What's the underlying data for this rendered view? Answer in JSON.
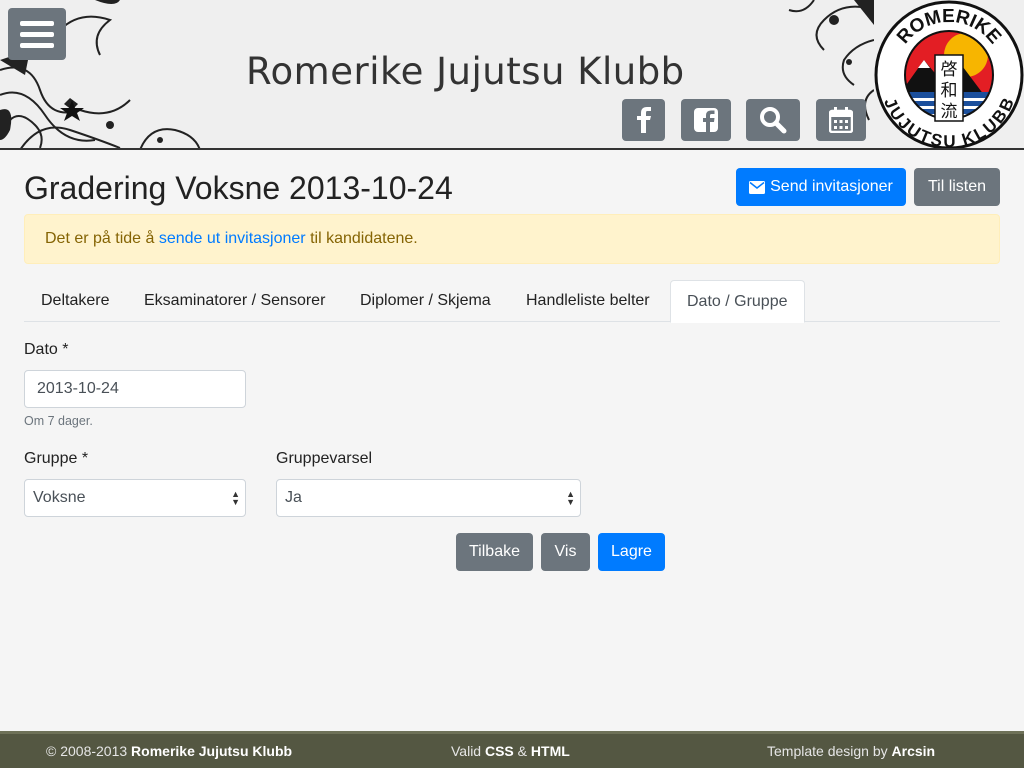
{
  "header": {
    "site_title": "Romerike Jujutsu Klubb",
    "menu_icon": "hamburger-menu-icon",
    "icons": [
      "facebook-icon",
      "facebook-square-icon",
      "search-icon",
      "calendar-icon"
    ],
    "logo": {
      "top_text": "ROMERIKE",
      "bottom_text": "JUJUTSU KLUBB",
      "kanji": [
        "啓",
        "和",
        "流"
      ]
    }
  },
  "main": {
    "title": "Gradering Voksne 2013-10-24",
    "send_button": "Send invitasjoner",
    "send_icon": "envelope-icon",
    "list_button": "Til listen",
    "alert": {
      "prefix": "Det er på tide å",
      "link": "sende ut invitasjoner",
      "suffix": "til kandidatene."
    },
    "tabs": [
      "Deltakere",
      "Eksaminatorer / Sensorer",
      "Diplomer / Skjema",
      "Handleliste belter",
      "Dato / Gruppe"
    ],
    "active_tab": "Dato / Gruppe",
    "form": {
      "date_label": "Dato *",
      "date_value": "2013-10-24",
      "date_help": "Om 7 dager.",
      "group_label": "Gruppe *",
      "group_value": "Voksne",
      "notify_label": "Gruppevarsel",
      "notify_value": "Ja"
    },
    "actions": {
      "back": "Tilbake",
      "view": "Vis",
      "save": "Lagre"
    }
  },
  "footer": {
    "copyright": "© 2008-2013",
    "club": "Romerike Jujutsu Klubb",
    "valid": "Valid",
    "css": "CSS",
    "amp": "&",
    "html": "HTML",
    "design_prefix": "Template design by",
    "designer": "Arcsin"
  },
  "colors": {
    "primary": "#007bff",
    "secondary": "#6c757d",
    "alert_bg": "#fff3cd",
    "alert_text": "#856404",
    "footer_bg": "#545742"
  }
}
